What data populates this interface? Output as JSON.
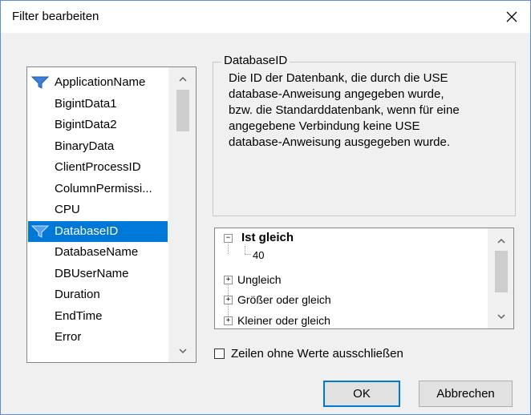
{
  "dialog": {
    "title": "Filter bearbeiten",
    "close_icon": "close-icon"
  },
  "columns": {
    "items": [
      {
        "label": "ApplicationName",
        "filtered": true,
        "selected": false
      },
      {
        "label": "BigintData1",
        "filtered": false,
        "selected": false
      },
      {
        "label": "BigintData2",
        "filtered": false,
        "selected": false
      },
      {
        "label": "BinaryData",
        "filtered": false,
        "selected": false
      },
      {
        "label": "ClientProcessID",
        "filtered": false,
        "selected": false
      },
      {
        "label": "ColumnPermissi...",
        "filtered": false,
        "selected": false
      },
      {
        "label": "CPU",
        "filtered": false,
        "selected": false
      },
      {
        "label": "DatabaseID",
        "filtered": true,
        "selected": true
      },
      {
        "label": "DatabaseName",
        "filtered": false,
        "selected": false
      },
      {
        "label": "DBUserName",
        "filtered": false,
        "selected": false
      },
      {
        "label": "Duration",
        "filtered": false,
        "selected": false
      },
      {
        "label": "EndTime",
        "filtered": false,
        "selected": false
      },
      {
        "label": "Error",
        "filtered": false,
        "selected": false
      }
    ],
    "filter_icon": "funnel-icon",
    "selected_color": "#0078d7",
    "icon_color": "#3c7fd6"
  },
  "description": {
    "title": "DatabaseID",
    "text": "Die ID der Datenbank, die durch die USE\ndatabase-Anweisung angegeben wurde,\nbzw. die Standarddatenbank, wenn für eine\nangegebene Verbindung keine USE\ndatabase-Anweisung ausgegeben wurde."
  },
  "conditions": {
    "nodes": [
      {
        "label": "Ist gleich",
        "expander": "⊟",
        "bold": true,
        "children": [
          "40"
        ]
      },
      {
        "label": "Ungleich",
        "expander": "⊞",
        "bold": false
      },
      {
        "label": "Größer oder gleich",
        "expander": "⊞",
        "bold": false
      },
      {
        "label": "Kleiner oder gleich",
        "expander": "⊞",
        "bold": false
      }
    ]
  },
  "exclude_empty": {
    "label": "Zeilen ohne Werte ausschließen",
    "checked": false
  },
  "buttons": {
    "ok": "OK",
    "cancel": "Abbrechen"
  }
}
